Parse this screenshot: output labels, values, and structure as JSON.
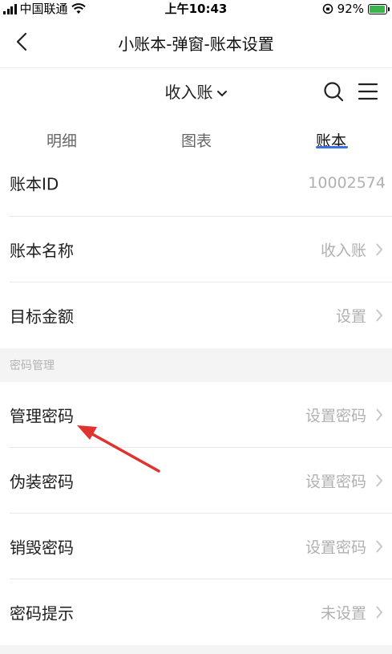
{
  "status_bar": {
    "carrier": "中国联通",
    "time": "上午10:43",
    "battery": "92%"
  },
  "nav": {
    "title": "小账本-弹窗-账本设置",
    "back_icon": "chevron-left-icon"
  },
  "book_bar": {
    "current_book": "收入账",
    "search_icon": "search-icon",
    "menu_icon": "hamburger-menu-icon"
  },
  "tabs": [
    {
      "label": "明细",
      "active": false
    },
    {
      "label": "图表",
      "active": false
    },
    {
      "label": "账本",
      "active": true
    }
  ],
  "accent_color": "#3c6fe0",
  "settings": {
    "book_id": {
      "label": "账本ID",
      "value": "10002574"
    },
    "book_name": {
      "label": "账本名称",
      "value": "收入账"
    },
    "target_amount": {
      "label": "目标金额",
      "value": "设置"
    },
    "password_section": "密码管理",
    "manage_password": {
      "label": "管理密码",
      "value": "设置密码"
    },
    "fake_password": {
      "label": "伪装密码",
      "value": "设置密码"
    },
    "destroy_password": {
      "label": "销毁密码",
      "value": "设置密码"
    },
    "password_hint": {
      "label": "密码提示",
      "value": "未设置"
    }
  },
  "annotation": {
    "color": "#e0322e",
    "target": "管理密码"
  }
}
